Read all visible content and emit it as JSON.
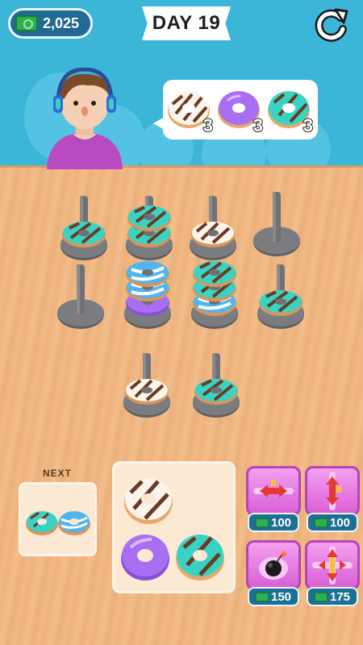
{
  "header": {
    "cash": "2,025",
    "day": "DAY 19",
    "restart_icon": "restart-icon"
  },
  "order": {
    "items": [
      {
        "donut": "white-chocolate-striped",
        "count": "3"
      },
      {
        "donut": "purple-glazed",
        "count": "3"
      },
      {
        "donut": "teal-chocolate-drizzle",
        "count": "3"
      }
    ]
  },
  "next": {
    "label": "NEXT"
  },
  "powerups": [
    {
      "icon": "swap-horizontal-icon",
      "price": "100"
    },
    {
      "icon": "swap-vertical-icon",
      "price": "100"
    },
    {
      "icon": "bomb-icon",
      "price": "150"
    },
    {
      "icon": "shuffle-icon",
      "price": "175"
    }
  ],
  "colors": {
    "teal": "#39d3c4",
    "chocolate": "#6b3a1f",
    "white": "#fbf5ee",
    "purple": "#a86ff2",
    "blue_striped": "#4fb6ef",
    "peg": "#6c6d70"
  }
}
